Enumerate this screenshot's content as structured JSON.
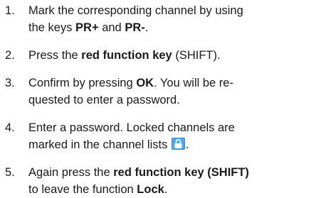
{
  "steps": [
    {
      "number": "1.",
      "line1": {
        "a": "Mark the corresponding channel by using"
      },
      "line2": {
        "a": "the keys ",
        "b1": "PR+",
        "c": " and ",
        "b2": "PR-",
        "d": "."
      }
    },
    {
      "number": "2.",
      "line1": {
        "a": "Press the ",
        "b": "red function key",
        "c": " (SHIFT)."
      }
    },
    {
      "number": "3.",
      "line1": {
        "a": "Confirm by pressing ",
        "b": "OK",
        "c": ". You will be re-"
      },
      "line2": {
        "a": "quested to enter a password."
      }
    },
    {
      "number": "4.",
      "line1": {
        "a": "Enter a password. Locked channels are"
      },
      "line2": {
        "a": "marked in the channel lists",
        "d": "."
      },
      "icon": "lock-icon"
    },
    {
      "number": "5.",
      "line1": {
        "a": "Again press the ",
        "b": "red function key (SHIFT)"
      },
      "line2": {
        "a": "to leave the function ",
        "b": "Lock",
        "c": "."
      }
    }
  ],
  "colors": {
    "text": "#1a1a1a",
    "lock_icon_bg": "#2a8fe0",
    "lock_icon_fg": "#ffffff"
  }
}
